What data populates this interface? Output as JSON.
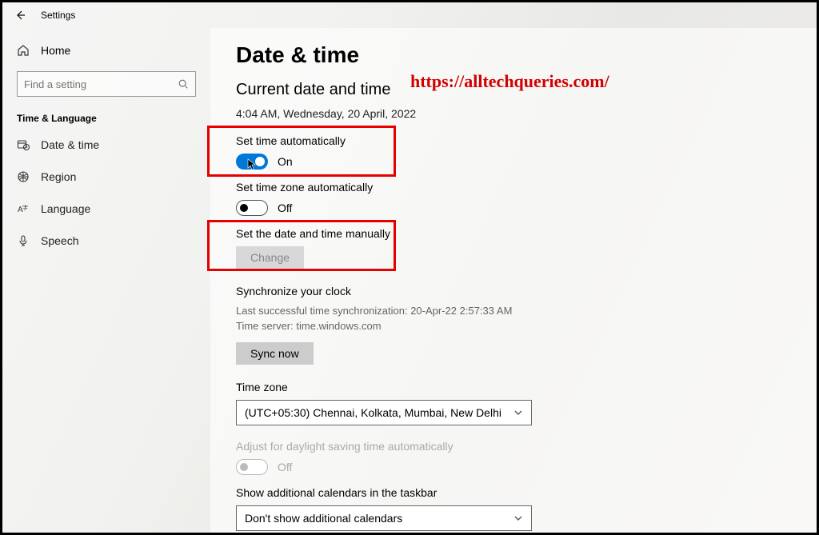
{
  "topbar": {
    "title": "Settings"
  },
  "sidebar": {
    "home": "Home",
    "search_placeholder": "Find a setting",
    "section": "Time & Language",
    "items": [
      {
        "label": "Date & time"
      },
      {
        "label": "Region"
      },
      {
        "label": "Language"
      },
      {
        "label": "Speech"
      }
    ]
  },
  "page": {
    "title": "Date & time",
    "subtitle": "Current date and time",
    "now": "4:04 AM, Wednesday, 20 April, 2022",
    "set_time_auto": {
      "label": "Set time automatically",
      "state": "On"
    },
    "set_tz_auto": {
      "label": "Set time zone automatically",
      "state": "Off"
    },
    "manual": {
      "label": "Set the date and time manually",
      "button": "Change"
    },
    "sync": {
      "heading": "Synchronize your clock",
      "last": "Last successful time synchronization: 20-Apr-22 2:57:33 AM",
      "server": "Time server: time.windows.com",
      "button": "Sync now"
    },
    "timezone": {
      "label": "Time zone",
      "value": "(UTC+05:30) Chennai, Kolkata, Mumbai, New Delhi"
    },
    "dst": {
      "label": "Adjust for daylight saving time automatically",
      "state": "Off"
    },
    "additional": {
      "label": "Show additional calendars in the taskbar",
      "value": "Don't show additional calendars"
    }
  },
  "watermark": "https://alltechqueries.com/"
}
